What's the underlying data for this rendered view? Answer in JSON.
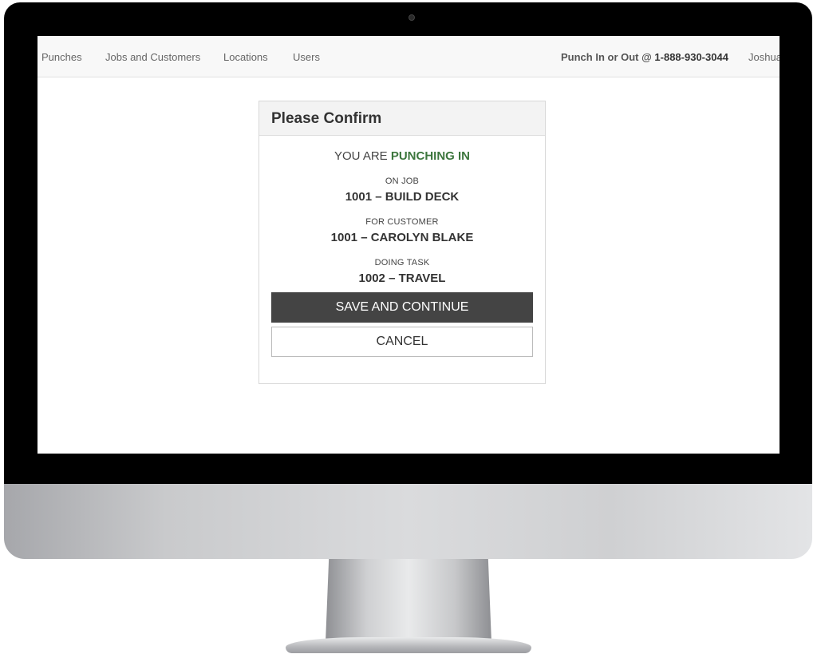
{
  "nav": {
    "items": [
      {
        "label": "Punches"
      },
      {
        "label": "Jobs and Customers"
      },
      {
        "label": "Locations"
      },
      {
        "label": "Users"
      }
    ],
    "punch_prefix": "Punch In or Out @ ",
    "punch_phone": "1-888-930-3044",
    "user": "Joshua"
  },
  "modal": {
    "title": "Please Confirm",
    "status_prefix": "YOU ARE ",
    "status_action": "PUNCHING IN",
    "job_label": "ON JOB",
    "job_value": "1001 – BUILD DECK",
    "customer_label": "FOR CUSTOMER",
    "customer_value": "1001 – CAROLYN BLAKE",
    "task_label": "DOING TASK",
    "task_value": "1002 – TRAVEL",
    "save_label": "SAVE AND CONTINUE",
    "cancel_label": "CANCEL"
  },
  "colors": {
    "status_action": "#3c763d",
    "primary_button": "#444444"
  }
}
